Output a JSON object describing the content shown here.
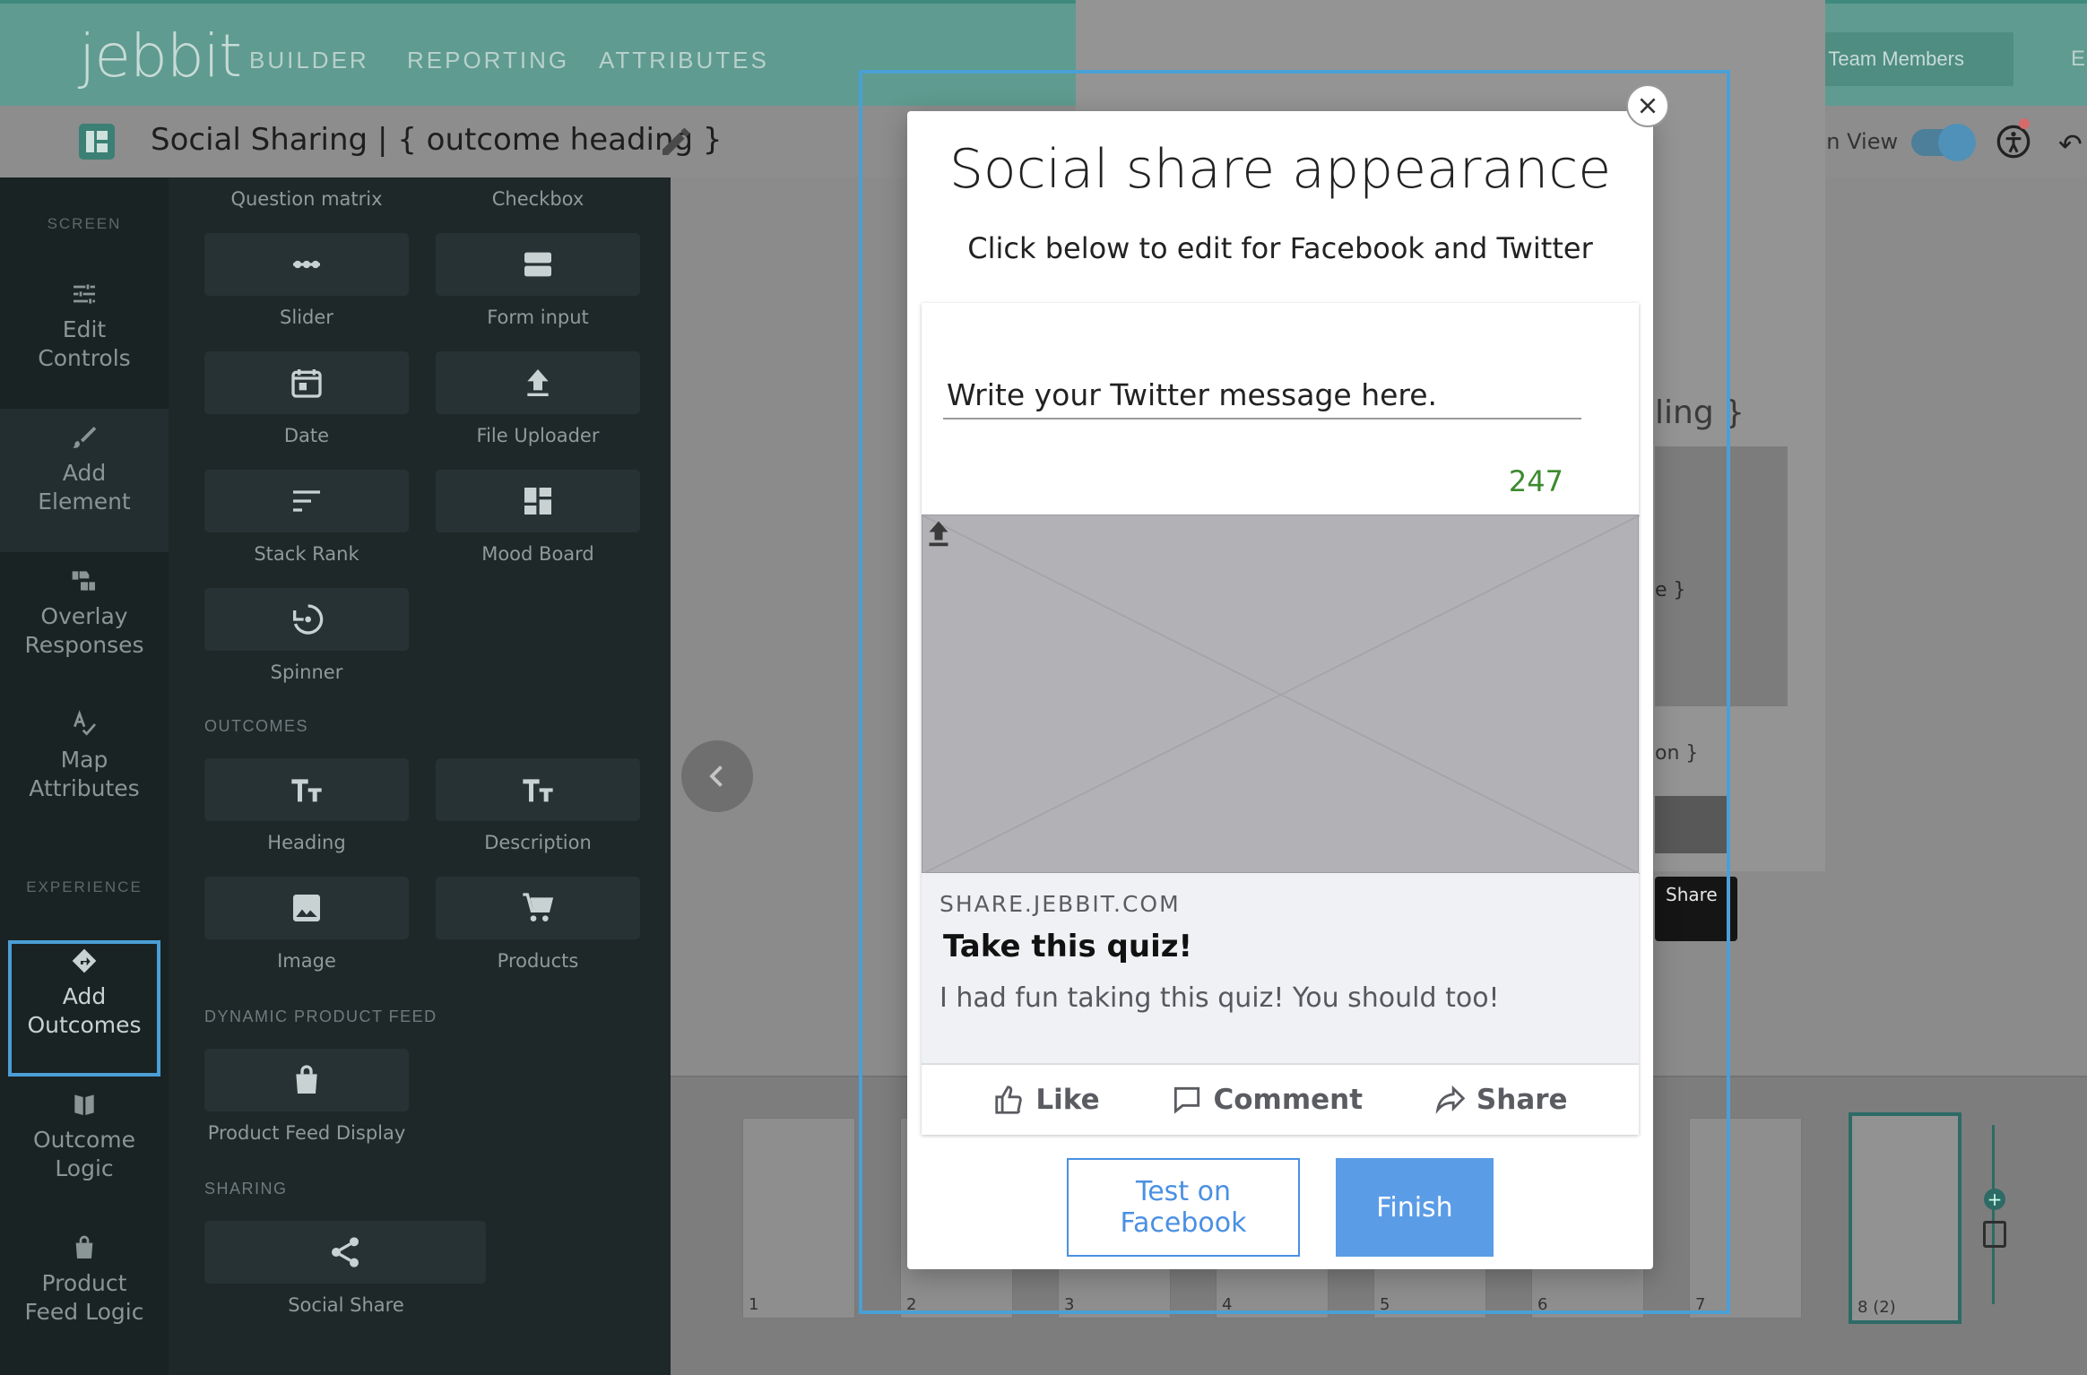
{
  "nav": {
    "logo": "jebbit",
    "links": [
      "BUILDER",
      "REPORTING",
      "ATTRIBUTES"
    ],
    "invite_label": "Invite Team Members",
    "edge_fragment": "E"
  },
  "titlebar": {
    "title": "Social Sharing | { outcome heading }",
    "screen_view_label": "Screen View",
    "screen_view_on": true
  },
  "rail": {
    "screen_section": "SCREEN",
    "experience_section": "EXPERIENCE",
    "items": [
      {
        "line1": "Edit",
        "line2": "Controls",
        "icon": "sliders-icon"
      },
      {
        "line1": "Add",
        "line2": "Element",
        "icon": "brush-icon"
      },
      {
        "line1": "Overlay",
        "line2": "Responses",
        "icon": "thumbs-icon"
      },
      {
        "line1": "Map",
        "line2": "Attributes",
        "icon": "spellcheck-icon"
      },
      {
        "line1": "Add",
        "line2": "Outcomes",
        "icon": "directions-icon"
      },
      {
        "line1": "Outcome",
        "line2": "Logic",
        "icon": "book-icon"
      },
      {
        "line1": "Product",
        "line2": "Feed Logic",
        "icon": "bag-icon"
      }
    ]
  },
  "panel": {
    "top_labels": [
      "Question matrix",
      "Checkbox"
    ],
    "tiles": {
      "slider": "Slider",
      "form_input": "Form input",
      "date": "Date",
      "file_uploader": "File Uploader",
      "stack_rank": "Stack Rank",
      "mood_board": "Mood Board",
      "spinner": "Spinner",
      "heading": "Heading",
      "description": "Description",
      "image": "Image",
      "products": "Products",
      "product_feed_display": "Product Feed Display",
      "social_share": "Social Share"
    },
    "sections": {
      "outcomes": "OUTCOMES",
      "dynamic_feed": "DYNAMIC PRODUCT FEED",
      "sharing": "SHARING"
    }
  },
  "background_preview": {
    "heading_fragment": "ling }",
    "image_fragment": "e }",
    "description_fragment": "on }",
    "share_label": "Share"
  },
  "filmstrip": {
    "numbers": [
      "1",
      "2",
      "3",
      "4",
      "5",
      "6",
      "7",
      "8"
    ],
    "active_badge": "(2)"
  },
  "modal": {
    "title": "Social share appearance",
    "subtitle": "Click below to edit for Facebook and Twitter",
    "twitter_message": "Write your Twitter message here.",
    "char_count": "247",
    "domain": "SHARE.JEBBIT.COM",
    "share_title": "Take this quiz!",
    "share_description": "I had fun taking this quiz! You should too!",
    "actions": {
      "like": "Like",
      "comment": "Comment",
      "share": "Share"
    },
    "test_button": "Test on Facebook",
    "finish_button": "Finish"
  },
  "colors": {
    "nav_bg": "#5f9b90",
    "rail_bg": "#1a2324",
    "panel_bg": "#1e2829",
    "selection": "#4a9fd5",
    "finish_bg": "#5b9ce6",
    "count_green": "#3d8a2f"
  }
}
